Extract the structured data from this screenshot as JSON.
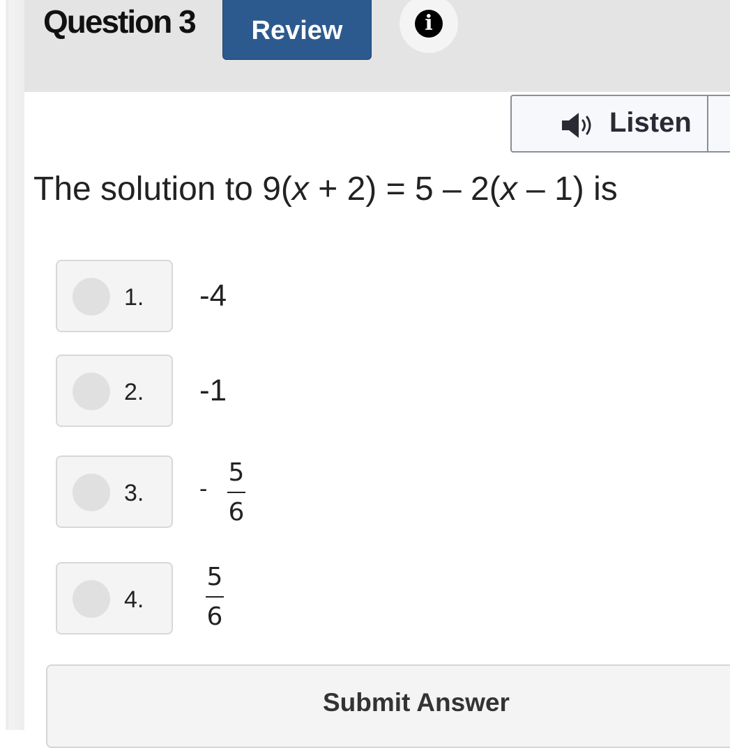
{
  "header": {
    "question_title": "Question 3",
    "review_label": "Review",
    "info_icon": "info-icon",
    "info_glyph": "i"
  },
  "toolbar": {
    "listen_label": "Listen",
    "speaker_icon": "speaker-icon"
  },
  "question": {
    "prefix": "The solution to 9(",
    "var1": "x",
    "middle": " + 2) = 5 – 2(",
    "var2": "x",
    "suffix": " – 1) is"
  },
  "options": [
    {
      "number": "1.",
      "value": "-4"
    },
    {
      "number": "2.",
      "value": "-1"
    },
    {
      "number": "3.",
      "sign": "-",
      "numerator": "5",
      "denominator": "6"
    },
    {
      "number": "4.",
      "numerator": "5",
      "denominator": "6"
    }
  ],
  "submit": {
    "label": "Submit Answer"
  },
  "colors": {
    "review_bg": "#2d5a8e",
    "header_bg": "#e4e4e4"
  }
}
